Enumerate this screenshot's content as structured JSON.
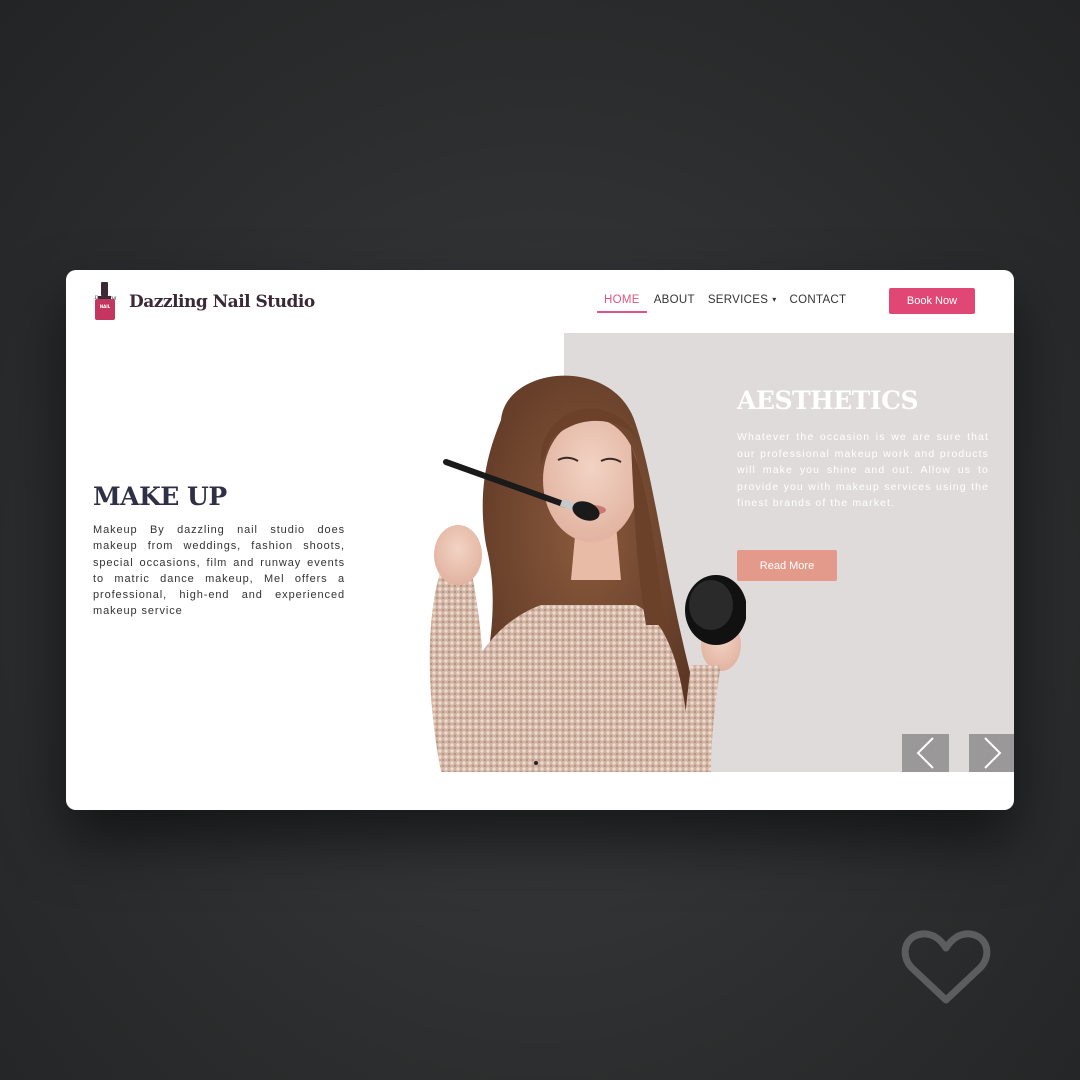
{
  "header": {
    "brand_name": "Dazzling Nail Studio",
    "logo_script": "Dazzling",
    "logo_tag": "NAIL"
  },
  "nav": {
    "items": [
      {
        "label": "HOME",
        "active": true
      },
      {
        "label": "ABOUT",
        "active": false
      },
      {
        "label": "SERVICES",
        "active": false,
        "dropdown": true
      },
      {
        "label": "CONTACT",
        "active": false
      }
    ],
    "book_label": "Book Now"
  },
  "hero": {
    "left_title": "MAKE UP",
    "left_text": "Makeup By dazzling nail studio does makeup from weddings, fashion shoots, special occasions, film and runway events to matric dance makeup, Mel offers a professional, high-end and experienced makeup service",
    "right_title": "AESTHETICS",
    "right_text": "Whatever the occasion is we are sure that our professional makeup work and products will make you shine and out. Allow us to provide you with makeup services using the finest brands of the market.",
    "read_more_label": "Read More"
  },
  "slider": {
    "current": 1,
    "total": 1
  },
  "colors": {
    "accent": "#e04775",
    "active_nav": "#e0557f",
    "read_more": "#e49a8a",
    "hero_panel": "#dfdbdb",
    "title_dark": "#2f2f45",
    "brand": "#3b2a35"
  },
  "icons": {
    "prev": "chevron-left-icon",
    "next": "chevron-right-icon",
    "favorite": "heart-icon",
    "dropdown": "chevron-down-icon"
  }
}
